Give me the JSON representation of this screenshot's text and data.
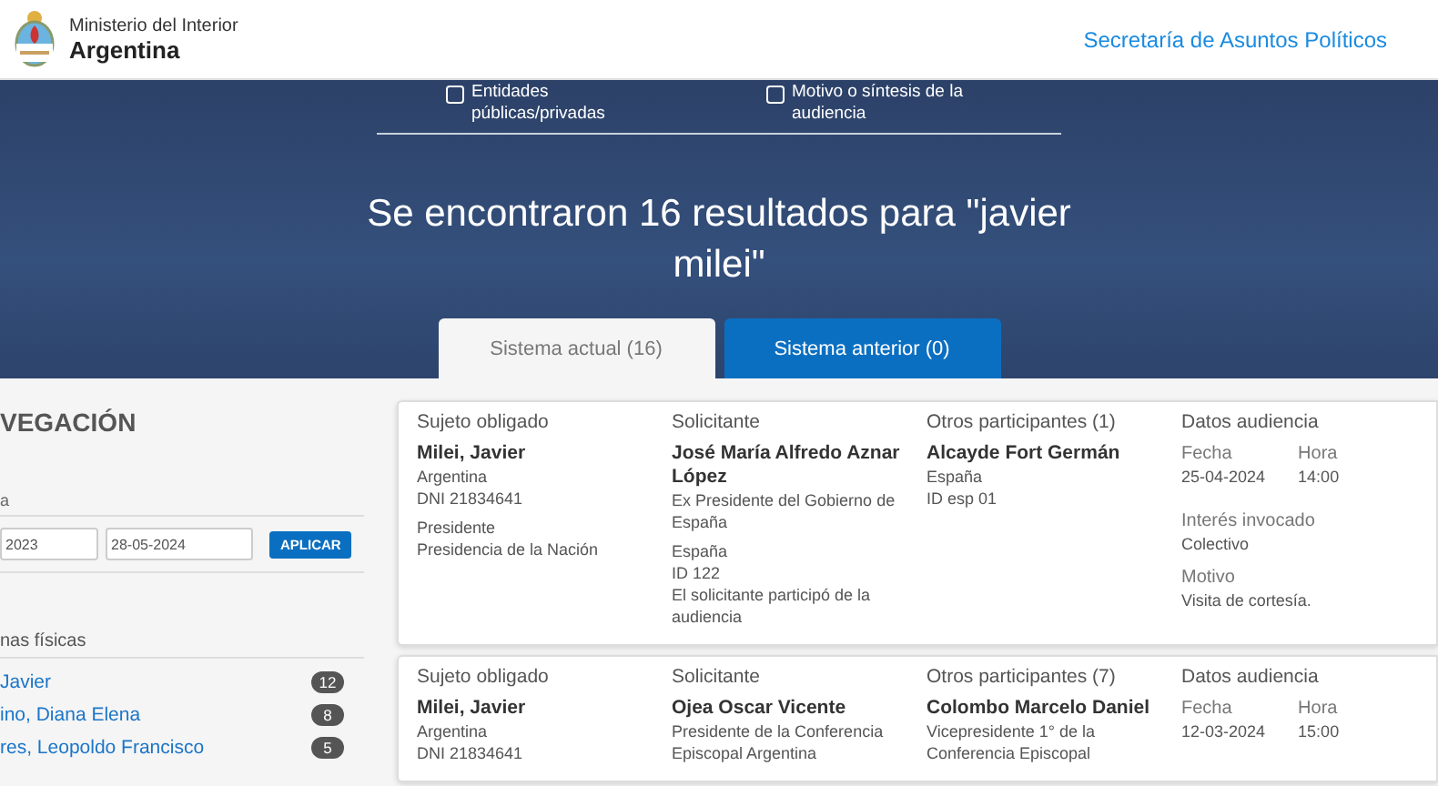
{
  "header": {
    "ministry": "Ministerio del Interior",
    "country": "Argentina",
    "link": "Secretaría de Asuntos Políticos"
  },
  "filters": [
    {
      "label": "Entidades públicas/privadas",
      "checked": false
    },
    {
      "label": "Motivo o síntesis de la audiencia",
      "checked": false
    }
  ],
  "results_title": "Se encontraron 16 resultados para \"javier milei\"",
  "tabs": [
    {
      "label": "Sistema actual (16)",
      "selected": true
    },
    {
      "label": "Sistema anterior (0)",
      "selected": false
    }
  ],
  "sidebar": {
    "title": "VEGACIÓN",
    "date_label": "a",
    "date_from": "2023",
    "date_to": "28-05-2024",
    "apply": "APLICAR",
    "section": "nas físicas",
    "items": [
      {
        "name": "Javier",
        "count": "12"
      },
      {
        "name": "ino, Diana Elena",
        "count": "8"
      },
      {
        "name": "res, Leopoldo Francisco",
        "count": "5"
      }
    ]
  },
  "cards": [
    {
      "sujeto": {
        "heading": "Sujeto obligado",
        "name": "Milei, Javier",
        "groups": [
          [
            "Argentina",
            "DNI 21834641"
          ],
          [
            "Presidente",
            "Presidencia de la Nación"
          ]
        ]
      },
      "solicitante": {
        "heading": "Solicitante",
        "name": "José María Alfredo Aznar López",
        "groups": [
          [
            "Ex Presidente del Gobierno de España"
          ],
          [
            "España",
            "ID 122",
            "El solicitante participó de la audiencia"
          ]
        ]
      },
      "otros": {
        "heading": "Otros participantes (1)",
        "name": "Alcayde Fort Germán",
        "groups": [
          [
            "España",
            "ID esp 01"
          ]
        ]
      },
      "datos": {
        "heading": "Datos audiencia",
        "pair": [
          {
            "label": "Fecha",
            "value": "25-04-2024"
          },
          {
            "label": "Hora",
            "value": "14:00"
          }
        ],
        "fields": [
          {
            "label": "Interés invocado",
            "value": "Colectivo"
          },
          {
            "label": "Motivo",
            "value": "Visita de cortesía."
          }
        ]
      }
    },
    {
      "sujeto": {
        "heading": "Sujeto obligado",
        "name": "Milei, Javier",
        "groups": [
          [
            "Argentina",
            "DNI 21834641"
          ]
        ]
      },
      "solicitante": {
        "heading": "Solicitante",
        "name": "Ojea Oscar Vicente",
        "groups": [
          [
            "Presidente de la Conferencia Episcopal Argentina"
          ]
        ]
      },
      "otros": {
        "heading": "Otros participantes (7)",
        "name": "Colombo Marcelo Daniel",
        "groups": [
          [
            "Vicepresidente 1° de la Conferencia Episcopal"
          ]
        ]
      },
      "datos": {
        "heading": "Datos audiencia",
        "pair": [
          {
            "label": "Fecha",
            "value": "12-03-2024"
          },
          {
            "label": "Hora",
            "value": "15:00"
          }
        ]
      }
    }
  ]
}
